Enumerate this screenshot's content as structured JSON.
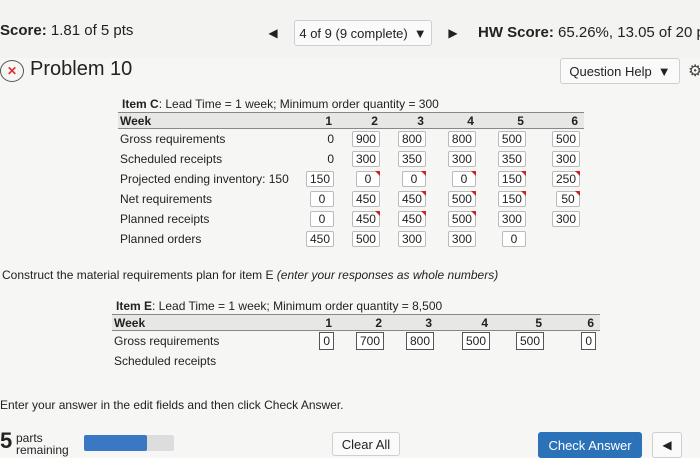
{
  "header": {
    "score_label": "Score:",
    "score_value": "1.81 of 5 pts",
    "nav_prev_icon": "triangle-left",
    "question_select": "4 of 9 (9 complete)",
    "nav_next_icon": "triangle-right",
    "hw_score_label": "HW Score:",
    "hw_score_value": "65.26%, 13.05 of 20 p"
  },
  "problem": {
    "title": "Problem 10",
    "question_help": "Question Help"
  },
  "item_c": {
    "title_bold": "Item C",
    "title_rest": ": Lead Time = 1 week; Minimum order quantity = 300",
    "week_label": "Week",
    "weeks": [
      "1",
      "2",
      "3",
      "4",
      "5",
      "6"
    ],
    "rows": [
      {
        "label": "Gross requirements",
        "initial": "",
        "values": [
          "0",
          "900",
          "800",
          "800",
          "500",
          "500"
        ]
      },
      {
        "label": "Scheduled receipts",
        "initial": "",
        "values": [
          "0",
          "300",
          "350",
          "300",
          "350",
          "300"
        ]
      },
      {
        "label": "Projected ending inventory: 150",
        "initial": "150",
        "values": [
          "",
          "0",
          "0",
          "0",
          "150",
          "250"
        ]
      },
      {
        "label": "Net requirements",
        "initial": "",
        "values": [
          "0",
          "450",
          "450",
          "500",
          "150",
          "50"
        ]
      },
      {
        "label": "Planned receipts",
        "initial": "",
        "values": [
          "0",
          "450",
          "450",
          "500",
          "300",
          "300"
        ]
      },
      {
        "label": "Planned orders",
        "initial": "450",
        "values": [
          "450",
          "500",
          "300",
          "300",
          "0",
          ""
        ]
      }
    ]
  },
  "construct_text": "Construct the material requirements plan for item E",
  "construct_italic": " (enter your responses as whole numbers)",
  "item_e": {
    "title_bold": "Item E",
    "title_rest": ": Lead Time = 1 week; Minimum order quantity = 8,500",
    "week_label": "Week",
    "weeks": [
      "1",
      "2",
      "3",
      "4",
      "5",
      "6"
    ],
    "gross_label": "Gross requirements",
    "gross_values": [
      "0",
      "700",
      "800",
      "500",
      "500",
      "0"
    ],
    "scheduled_label": "Scheduled receipts"
  },
  "enter_text": "Enter your answer in the edit fields and then click Check Answer.",
  "footer": {
    "parts_num": "5",
    "parts_label_1": "parts",
    "parts_label_2": "remaining",
    "progress_fraction": 0.7,
    "clear_all": "Clear All",
    "check_answer": "Check Answer"
  }
}
